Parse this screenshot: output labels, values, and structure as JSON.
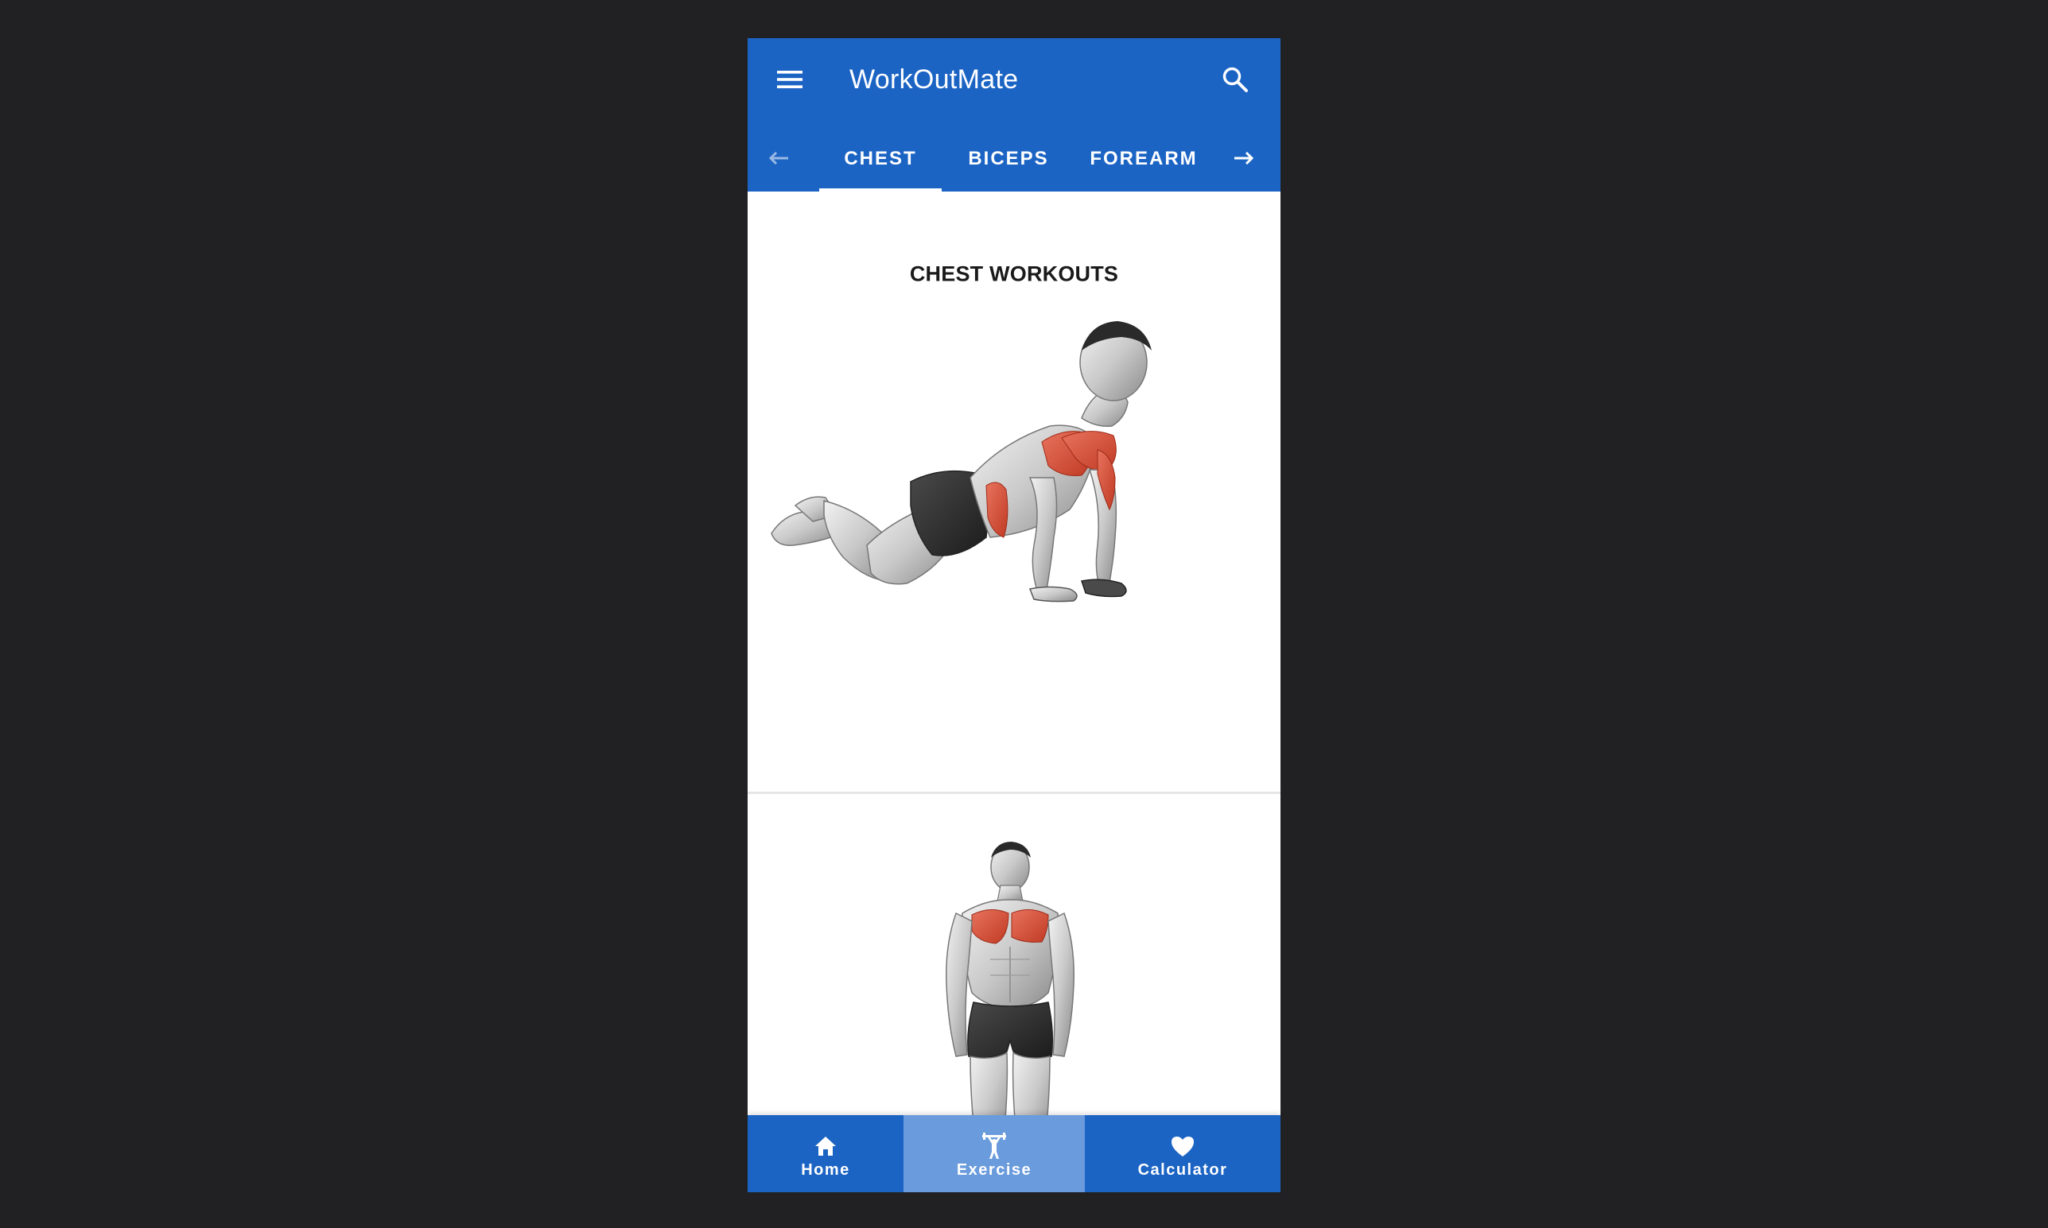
{
  "app": {
    "title": "WorkOutMate"
  },
  "colors": {
    "primary": "#1c64c4",
    "active_nav": "#6a9bdc",
    "background": "#212123",
    "muscle_highlight": "#d8472f"
  },
  "header": {
    "menu_icon": "hamburger-menu-icon",
    "search_icon": "search-icon"
  },
  "tabs": {
    "prev_icon": "arrow-left-icon",
    "next_icon": "arrow-right-icon",
    "items": [
      {
        "label": "CHEST",
        "active": true
      },
      {
        "label": "BICEPS",
        "active": false
      },
      {
        "label": "FOREARM",
        "active": false
      }
    ]
  },
  "main": {
    "section_title": "CHEST WORKOUTS",
    "exercises": [
      {
        "illustration": "kneeling-push-up-illustration"
      },
      {
        "illustration": "standing-chest-illustration"
      }
    ]
  },
  "bottom_nav": {
    "items": [
      {
        "label": "Home",
        "icon": "home-icon",
        "active": false
      },
      {
        "label": "Exercise",
        "icon": "dumbbell-icon",
        "active": true
      },
      {
        "label": "Calculator",
        "icon": "heart-icon",
        "active": false
      }
    ]
  }
}
